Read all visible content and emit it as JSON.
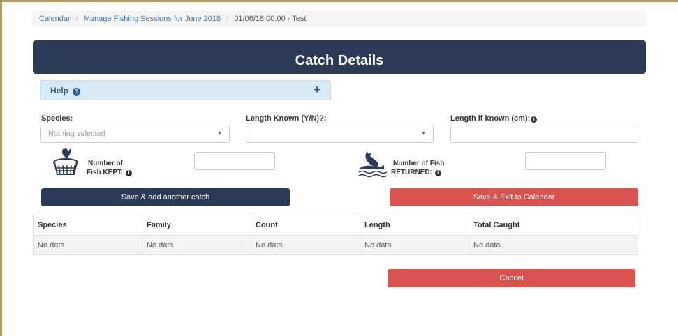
{
  "breadcrumb": {
    "items": [
      "Calendar",
      "Manage Fishing Sessions for June 2018"
    ],
    "current": "01/06/18 00:00 - Test",
    "separator": "/"
  },
  "header": {
    "title": "Catch Details"
  },
  "help": {
    "label": "Help",
    "help_icon": "?",
    "toggle": "+"
  },
  "form": {
    "species_label": "Species:",
    "species_value": "Nothing selected",
    "length_known_label": "Length Known (Y/N)?:",
    "length_known_value": "",
    "length_if_known_label": "Length if known (cm):",
    "length_if_known_value": "",
    "kept_label_line1": "Number of",
    "kept_label_line2": "Fish KEPT:",
    "kept_value": "",
    "returned_label_line1": "Number of Fish",
    "returned_label_line2": "RETURNED:",
    "returned_value": "",
    "info_icon": "i",
    "caret": "▼"
  },
  "buttons": {
    "save_add": "Save & add another catch",
    "save_exit": "Save & Exit to Calendar",
    "cancel": "Cancel"
  },
  "table": {
    "headers": [
      "Species",
      "Family",
      "Count",
      "Length",
      "Total Caught"
    ],
    "rows": [
      [
        "No data",
        "No data",
        "No data",
        "No data",
        "No data"
      ]
    ]
  },
  "colors": {
    "navy": "#2b3a56",
    "red": "#d9534f",
    "help_bg": "#d6ebf5",
    "link": "#3c7ab8",
    "frame": "#a99a6a"
  },
  "icons": {
    "kept": "fish-in-basket-icon",
    "returned": "fish-returned-to-water-icon",
    "info": "info-circle-icon",
    "help": "question-circle-icon"
  }
}
